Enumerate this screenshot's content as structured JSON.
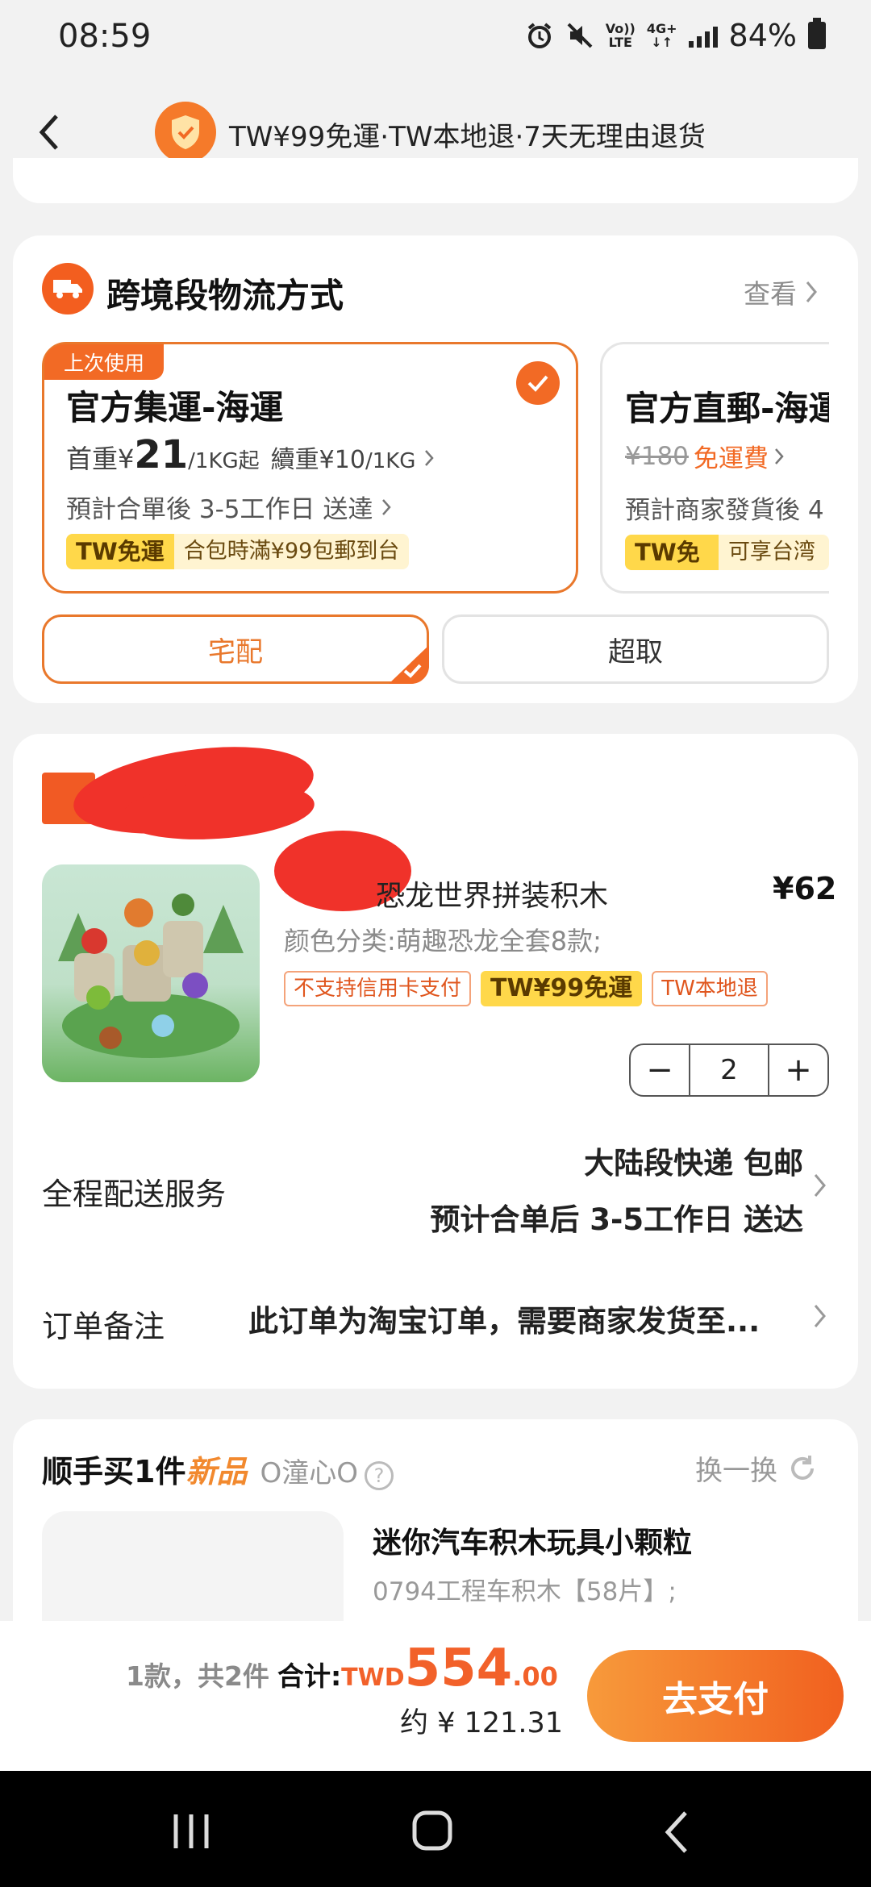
{
  "status": {
    "time": "08:59",
    "volte_top": "Vo))",
    "volte_bottom": "LTE",
    "net_top": "4G+",
    "net_bottom": "↓↑",
    "battery": "84%"
  },
  "topbar": {
    "title": "TW¥99免運·TW本地退·7天无理由退货"
  },
  "logistics": {
    "title": "跨境段物流方式",
    "view": "查看",
    "options": [
      {
        "badge": "上次使用",
        "name": "官方集運-海運",
        "first_label": "首重¥",
        "first_price": "21",
        "first_unit": "/1KG起",
        "cont": "續重¥10",
        "cont_unit": "/1KG",
        "eta": "預計合單後 3-5工作日 送達",
        "tag_a": "TW免運",
        "tag_b": "合包時滿¥99包郵到台"
      },
      {
        "name": "官方直郵-海運",
        "orig_price": "¥180",
        "free": "免運費",
        "eta": "預計商家發貨後 4",
        "tag_a": "TW免運",
        "tag_b": "可享台湾满"
      }
    ],
    "delivery": [
      "宅配",
      "超取"
    ]
  },
  "product": {
    "name_tail": "恐龙世界拼装积木",
    "price": "¥62",
    "variant": "颜色分类:萌趣恐龙全套8款;",
    "tags": [
      "不支持信用卡支付",
      "TW¥99免運",
      "TW本地退"
    ],
    "qty": "2",
    "minus": "−",
    "plus": "+",
    "shipping_label": "全程配送服务",
    "shipping_line1": "大陆段快递 包邮",
    "shipping_line2": "预计合单后 3-5工作日 送达",
    "note_label": "订单备注",
    "note_value": "此订单为淘宝订单，需要商家发货至..."
  },
  "addon": {
    "title_a": "顺手买1件",
    "title_b": "新品",
    "subtitle": "O潼心O",
    "help": "?",
    "swap": "换一换",
    "item_name": "迷你汽车积木玩具小颗粒",
    "item_variant": "0794工程车积木【58片】;"
  },
  "footer": {
    "count": "1款，共2件",
    "total_label": "合计:",
    "currency": "TWD",
    "amount_int": "554",
    "amount_dec": ".00",
    "approx": "约 ¥ 121.31",
    "pay": "去支付"
  },
  "colors": {
    "accent": "#f26a25",
    "yellow": "#ffd84a"
  }
}
